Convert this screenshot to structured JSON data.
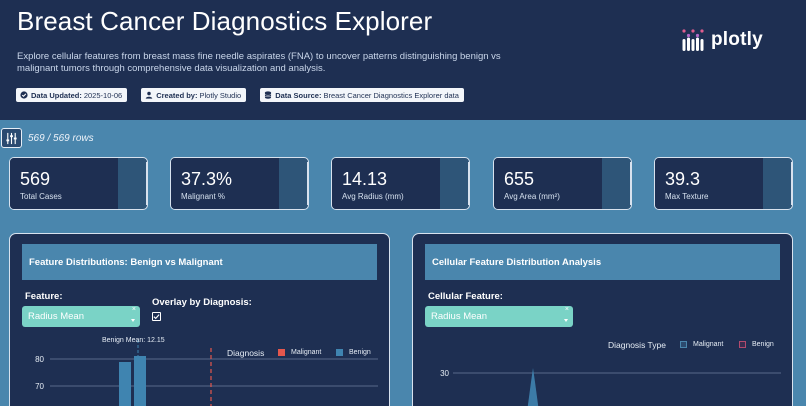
{
  "header": {
    "title": "Breast Cancer Diagnostics Explorer",
    "subtitle": "Explore cellular features from breast mass fine needle aspirates (FNA) to uncover patterns distinguishing benign vs malignant tumors through comprehensive data visualization and analysis.",
    "badges": [
      {
        "key": "Data Updated:",
        "value": "2025-10-06",
        "icon": "check-circle-icon"
      },
      {
        "key": "Created by:",
        "value": "Plotly Studio",
        "icon": "user-icon"
      },
      {
        "key": "Data Source:",
        "value": "Breast Cancer Diagnostics Explorer data",
        "icon": "database-icon"
      }
    ],
    "logo_text": "plotly"
  },
  "filter": {
    "rows_text": "569 / 569 rows",
    "icon": "sliders-icon"
  },
  "kpis": [
    {
      "value": "569",
      "label": "Total Cases"
    },
    {
      "value": "37.3%",
      "label": "Malignant %"
    },
    {
      "value": "14.13",
      "label": "Avg Radius (mm)"
    },
    {
      "value": "655",
      "label": "Avg Area (mm²)"
    },
    {
      "value": "39.3",
      "label": "Max Texture"
    }
  ],
  "colors": {
    "header_bg": "#1e2f52",
    "page_bg": "#4a86ad",
    "select_bg": "#7ad3c6",
    "malignant": "#e4574d",
    "benign": "#3f84b0",
    "malignant_alt": "#9b3b5d",
    "benign_alt": "#2c6c8c"
  },
  "card_left": {
    "title": "Feature Distributions: Benign vs Malignant",
    "feature_label": "Feature:",
    "feature_value": "Radius Mean",
    "overlay_label": "Overlay by Diagnosis:",
    "overlay_checked": true,
    "annotation": "Benign Mean: 12.15",
    "legend_title": "Diagnosis",
    "legend_items": [
      "Malignant",
      "Benign"
    ]
  },
  "card_right": {
    "title": "Cellular Feature Distribution Analysis",
    "feature_label": "Cellular Feature:",
    "feature_value": "Radius Mean",
    "legend_title": "Diagnosis Type",
    "legend_items": [
      "Malignant",
      "Benign"
    ]
  },
  "chart_data": [
    {
      "type": "bar",
      "title": "",
      "y_ticks": [
        "80",
        "70"
      ],
      "ylim": [
        60,
        85
      ],
      "series": [
        {
          "name": "Benign",
          "values": [
            79,
            80.5
          ]
        }
      ],
      "annotation": "Benign Mean: 12.15"
    },
    {
      "type": "area",
      "title": "",
      "y_ticks": [
        "30"
      ],
      "series": [
        {
          "name": "Malignant",
          "values": []
        },
        {
          "name": "Benign",
          "values": []
        }
      ]
    }
  ]
}
